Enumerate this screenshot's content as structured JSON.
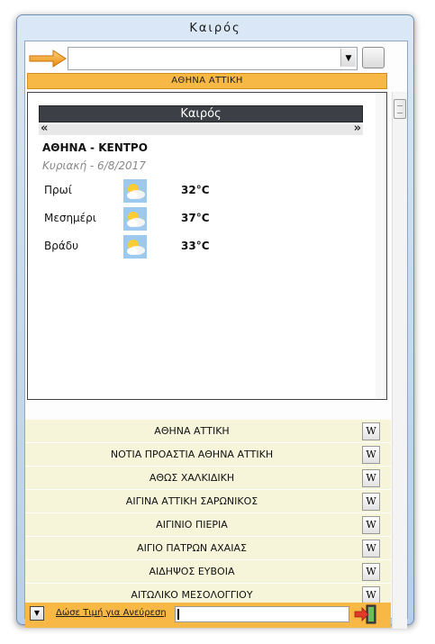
{
  "window": {
    "title": "Καιρός"
  },
  "toolbar": {
    "combo_value": ""
  },
  "region": {
    "label": "ΑΘΗΝΑ  ΑΤΤΙΚΗ"
  },
  "widget": {
    "header": "Καιρός",
    "prev": "«",
    "next": "»",
    "location": "ΑΘΗΝΑ - ΚΕΝΤΡΟ",
    "date": "Κυριακή - 6/8/2017",
    "forecast": [
      {
        "label": "Πρωί",
        "icon": "partly-cloudy-icon",
        "temp": "32°C"
      },
      {
        "label": "Μεσημέρι",
        "icon": "partly-cloudy-icon",
        "temp": "37°C"
      },
      {
        "label": "Βράδυ",
        "icon": "partly-cloudy-icon",
        "temp": "33°C"
      }
    ]
  },
  "list": [
    {
      "name": "ΑΘΗΝΑ  ΑΤΤΙΚΗ"
    },
    {
      "name": "ΝΟΤΙΑ ΠΡΟΑΣΤΙΑ  ΑΘΗΝΑ ΑΤΤΙΚΗ"
    },
    {
      "name": "ΑΘΩΣ ΧΑΛΚΙΔΙΚΗ"
    },
    {
      "name": "ΑΙΓΙΝΑ  ΑΤΤΙΚΗ ΣΑΡΩΝΙΚΟΣ"
    },
    {
      "name": "ΑΙΓΙΝΙΟ  ΠΙΕΡΙΑ"
    },
    {
      "name": "ΑΙΓΙΟ ΠΑΤΡΩΝ ΑΧΑΙΑΣ"
    },
    {
      "name": "ΑΙΔΗΨΟΣ ΕΥΒΟΙΑ"
    },
    {
      "name": "ΑΙΤΩΛΙΚΟ ΜΕΣΟΛΟΓΓΙΟΥ"
    }
  ],
  "wiki_glyph": "W",
  "bottom": {
    "drop_glyph": "▼",
    "search_link": "Δώσε Τιμή για Ανεύρεση",
    "search_value": ""
  },
  "colors": {
    "accent": "#f7b846",
    "list_bg": "#f6f5da",
    "header_bg": "#3c3f45"
  }
}
